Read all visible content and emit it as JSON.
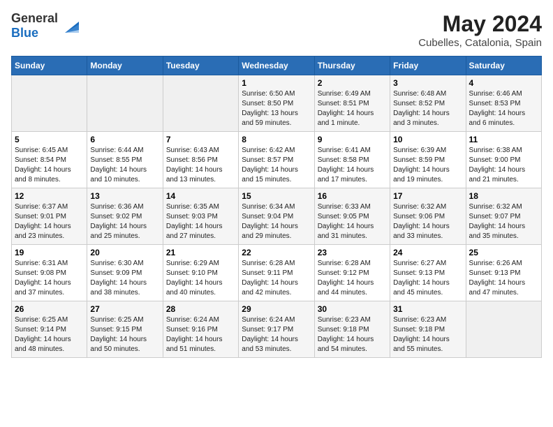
{
  "header": {
    "logo_general": "General",
    "logo_blue": "Blue",
    "title": "May 2024",
    "subtitle": "Cubelles, Catalonia, Spain"
  },
  "calendar": {
    "days_of_week": [
      "Sunday",
      "Monday",
      "Tuesday",
      "Wednesday",
      "Thursday",
      "Friday",
      "Saturday"
    ],
    "weeks": [
      [
        {
          "day": "",
          "sunrise": "",
          "sunset": "",
          "daylight": ""
        },
        {
          "day": "",
          "sunrise": "",
          "sunset": "",
          "daylight": ""
        },
        {
          "day": "",
          "sunrise": "",
          "sunset": "",
          "daylight": ""
        },
        {
          "day": "1",
          "sunrise": "Sunrise: 6:50 AM",
          "sunset": "Sunset: 8:50 PM",
          "daylight": "Daylight: 13 hours and 59 minutes."
        },
        {
          "day": "2",
          "sunrise": "Sunrise: 6:49 AM",
          "sunset": "Sunset: 8:51 PM",
          "daylight": "Daylight: 14 hours and 1 minute."
        },
        {
          "day": "3",
          "sunrise": "Sunrise: 6:48 AM",
          "sunset": "Sunset: 8:52 PM",
          "daylight": "Daylight: 14 hours and 3 minutes."
        },
        {
          "day": "4",
          "sunrise": "Sunrise: 6:46 AM",
          "sunset": "Sunset: 8:53 PM",
          "daylight": "Daylight: 14 hours and 6 minutes."
        }
      ],
      [
        {
          "day": "5",
          "sunrise": "Sunrise: 6:45 AM",
          "sunset": "Sunset: 8:54 PM",
          "daylight": "Daylight: 14 hours and 8 minutes."
        },
        {
          "day": "6",
          "sunrise": "Sunrise: 6:44 AM",
          "sunset": "Sunset: 8:55 PM",
          "daylight": "Daylight: 14 hours and 10 minutes."
        },
        {
          "day": "7",
          "sunrise": "Sunrise: 6:43 AM",
          "sunset": "Sunset: 8:56 PM",
          "daylight": "Daylight: 14 hours and 13 minutes."
        },
        {
          "day": "8",
          "sunrise": "Sunrise: 6:42 AM",
          "sunset": "Sunset: 8:57 PM",
          "daylight": "Daylight: 14 hours and 15 minutes."
        },
        {
          "day": "9",
          "sunrise": "Sunrise: 6:41 AM",
          "sunset": "Sunset: 8:58 PM",
          "daylight": "Daylight: 14 hours and 17 minutes."
        },
        {
          "day": "10",
          "sunrise": "Sunrise: 6:39 AM",
          "sunset": "Sunset: 8:59 PM",
          "daylight": "Daylight: 14 hours and 19 minutes."
        },
        {
          "day": "11",
          "sunrise": "Sunrise: 6:38 AM",
          "sunset": "Sunset: 9:00 PM",
          "daylight": "Daylight: 14 hours and 21 minutes."
        }
      ],
      [
        {
          "day": "12",
          "sunrise": "Sunrise: 6:37 AM",
          "sunset": "Sunset: 9:01 PM",
          "daylight": "Daylight: 14 hours and 23 minutes."
        },
        {
          "day": "13",
          "sunrise": "Sunrise: 6:36 AM",
          "sunset": "Sunset: 9:02 PM",
          "daylight": "Daylight: 14 hours and 25 minutes."
        },
        {
          "day": "14",
          "sunrise": "Sunrise: 6:35 AM",
          "sunset": "Sunset: 9:03 PM",
          "daylight": "Daylight: 14 hours and 27 minutes."
        },
        {
          "day": "15",
          "sunrise": "Sunrise: 6:34 AM",
          "sunset": "Sunset: 9:04 PM",
          "daylight": "Daylight: 14 hours and 29 minutes."
        },
        {
          "day": "16",
          "sunrise": "Sunrise: 6:33 AM",
          "sunset": "Sunset: 9:05 PM",
          "daylight": "Daylight: 14 hours and 31 minutes."
        },
        {
          "day": "17",
          "sunrise": "Sunrise: 6:32 AM",
          "sunset": "Sunset: 9:06 PM",
          "daylight": "Daylight: 14 hours and 33 minutes."
        },
        {
          "day": "18",
          "sunrise": "Sunrise: 6:32 AM",
          "sunset": "Sunset: 9:07 PM",
          "daylight": "Daylight: 14 hours and 35 minutes."
        }
      ],
      [
        {
          "day": "19",
          "sunrise": "Sunrise: 6:31 AM",
          "sunset": "Sunset: 9:08 PM",
          "daylight": "Daylight: 14 hours and 37 minutes."
        },
        {
          "day": "20",
          "sunrise": "Sunrise: 6:30 AM",
          "sunset": "Sunset: 9:09 PM",
          "daylight": "Daylight: 14 hours and 38 minutes."
        },
        {
          "day": "21",
          "sunrise": "Sunrise: 6:29 AM",
          "sunset": "Sunset: 9:10 PM",
          "daylight": "Daylight: 14 hours and 40 minutes."
        },
        {
          "day": "22",
          "sunrise": "Sunrise: 6:28 AM",
          "sunset": "Sunset: 9:11 PM",
          "daylight": "Daylight: 14 hours and 42 minutes."
        },
        {
          "day": "23",
          "sunrise": "Sunrise: 6:28 AM",
          "sunset": "Sunset: 9:12 PM",
          "daylight": "Daylight: 14 hours and 44 minutes."
        },
        {
          "day": "24",
          "sunrise": "Sunrise: 6:27 AM",
          "sunset": "Sunset: 9:13 PM",
          "daylight": "Daylight: 14 hours and 45 minutes."
        },
        {
          "day": "25",
          "sunrise": "Sunrise: 6:26 AM",
          "sunset": "Sunset: 9:13 PM",
          "daylight": "Daylight: 14 hours and 47 minutes."
        }
      ],
      [
        {
          "day": "26",
          "sunrise": "Sunrise: 6:25 AM",
          "sunset": "Sunset: 9:14 PM",
          "daylight": "Daylight: 14 hours and 48 minutes."
        },
        {
          "day": "27",
          "sunrise": "Sunrise: 6:25 AM",
          "sunset": "Sunset: 9:15 PM",
          "daylight": "Daylight: 14 hours and 50 minutes."
        },
        {
          "day": "28",
          "sunrise": "Sunrise: 6:24 AM",
          "sunset": "Sunset: 9:16 PM",
          "daylight": "Daylight: 14 hours and 51 minutes."
        },
        {
          "day": "29",
          "sunrise": "Sunrise: 6:24 AM",
          "sunset": "Sunset: 9:17 PM",
          "daylight": "Daylight: 14 hours and 53 minutes."
        },
        {
          "day": "30",
          "sunrise": "Sunrise: 6:23 AM",
          "sunset": "Sunset: 9:18 PM",
          "daylight": "Daylight: 14 hours and 54 minutes."
        },
        {
          "day": "31",
          "sunrise": "Sunrise: 6:23 AM",
          "sunset": "Sunset: 9:18 PM",
          "daylight": "Daylight: 14 hours and 55 minutes."
        },
        {
          "day": "",
          "sunrise": "",
          "sunset": "",
          "daylight": ""
        }
      ]
    ]
  }
}
